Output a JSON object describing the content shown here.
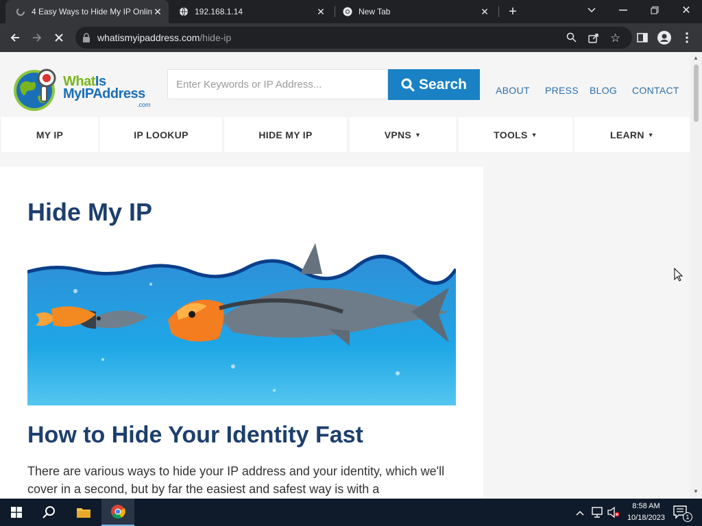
{
  "browser": {
    "tabs": [
      {
        "title": "4 Easy Ways to Hide My IP Online",
        "favicon": "loading-spinner-icon",
        "active": true
      },
      {
        "title": "192.168.1.14",
        "favicon": "globe-icon",
        "active": false
      },
      {
        "title": "New Tab",
        "favicon": "chrome-icon",
        "active": false
      }
    ],
    "url_host": "whatismyipaddress.com",
    "url_path": "/hide-ip"
  },
  "site": {
    "logo_line1_a": "What",
    "logo_line1_b": "Is",
    "logo_line2": "MyIPAddress",
    "logo_line3": ".com",
    "search_placeholder": "Enter Keywords or IP Address...",
    "search_button": "Search",
    "header_links": [
      "ABOUT",
      "PRESS",
      "BLOG",
      "CONTACT"
    ],
    "nav": [
      {
        "label": "MY IP",
        "dropdown": false
      },
      {
        "label": "IP LOOKUP",
        "dropdown": false
      },
      {
        "label": "HIDE MY IP",
        "dropdown": false
      },
      {
        "label": "VPNS",
        "dropdown": true
      },
      {
        "label": "TOOLS",
        "dropdown": true
      },
      {
        "label": "LEARN",
        "dropdown": true
      }
    ]
  },
  "article": {
    "title": "Hide My IP",
    "subtitle": "How to Hide Your Identity Fast",
    "paragraph": "There are various ways to hide your IP address and your identity, which we'll cover in a second, but by far the easiest and safest way is with a"
  },
  "taskbar": {
    "time": "8:58 AM",
    "date": "10/18/2023",
    "notification_count": "1"
  },
  "colors": {
    "brand_blue": "#1a82c4",
    "heading": "#1d3f6e",
    "logo_green": "#7ab51d"
  }
}
